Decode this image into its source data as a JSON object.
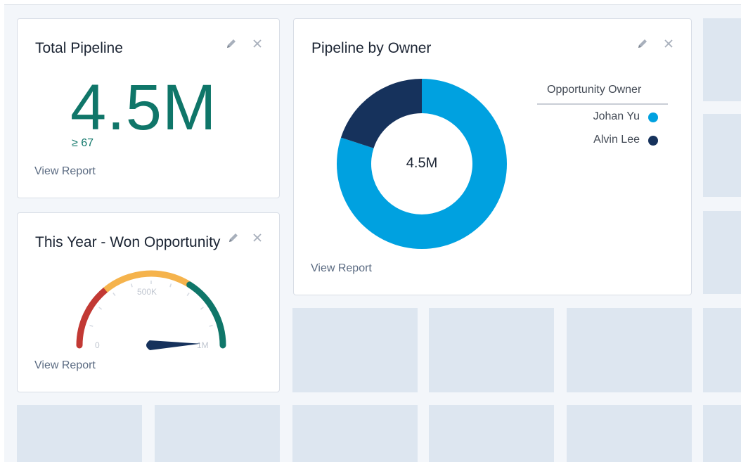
{
  "cards": {
    "total_pipeline": {
      "title": "Total Pipeline",
      "value": "4.5M",
      "sub_value": "≥ 67",
      "view_report": "View Report"
    },
    "won_opportunity": {
      "title": "This Year - Won Opportunity",
      "view_report": "View Report",
      "gauge": {
        "min_label": "0",
        "mid_label": "500K",
        "max_label": "1M",
        "needle_fraction": 0.99,
        "bands": [
          {
            "color": "#c23934",
            "from": 0,
            "to": 0.28
          },
          {
            "color": "#f5b34c",
            "from": 0.28,
            "to": 0.68
          },
          {
            "color": "#0f7669",
            "from": 0.68,
            "to": 1.0
          }
        ]
      }
    },
    "pipeline_by_owner": {
      "title": "Pipeline by Owner",
      "center_label": "4.5M",
      "legend_title": "Opportunity Owner",
      "view_report": "View Report",
      "segments": [
        {
          "name": "Johan Yu",
          "fraction": 0.8,
          "color": "#00a1e0"
        },
        {
          "name": "Alvin Lee",
          "fraction": 0.2,
          "color": "#16325c"
        }
      ]
    }
  }
}
